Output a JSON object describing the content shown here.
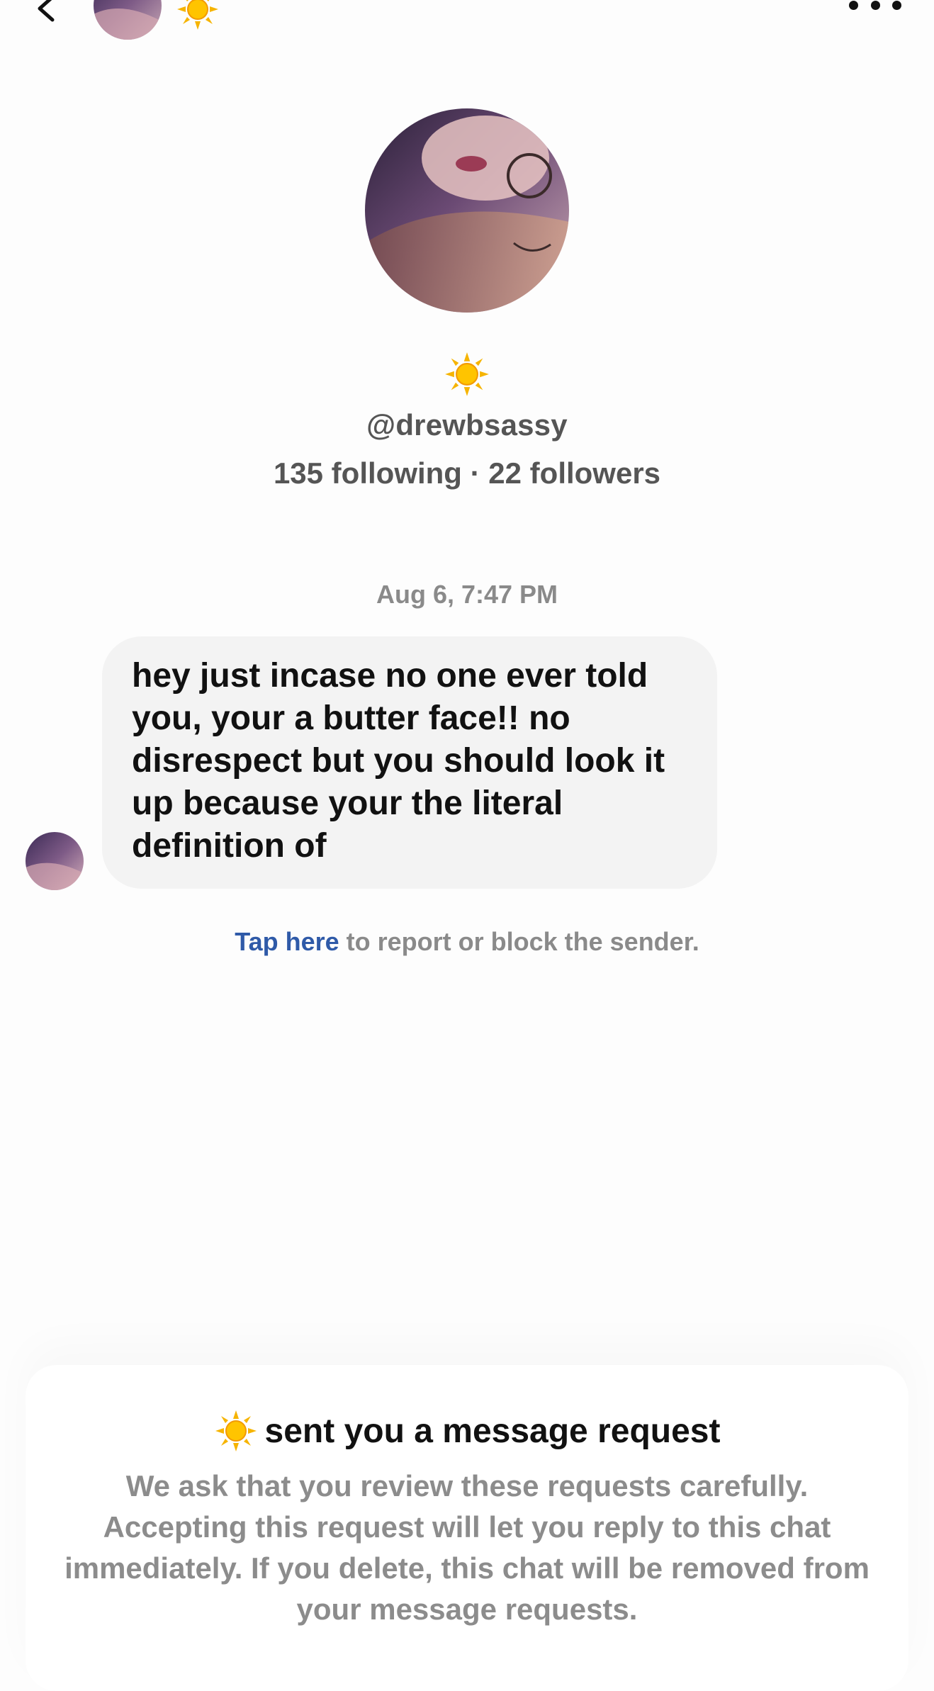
{
  "header": {
    "back_icon": "chevron-left-icon",
    "avatar": "profile-photo",
    "name_emoji_icon": "sun-icon",
    "more_icon": "ellipsis-icon"
  },
  "profile": {
    "avatar": "profile-photo",
    "emoji_icon": "sun-icon",
    "username": "@drewbsassy",
    "stats": "135 following · 22 followers"
  },
  "conversation": {
    "timestamp": "Aug 6, 7:47 PM",
    "message_text": "hey just incase no one ever told you, your a butter face!! no disrespect but you should look it up because your the literal definition of",
    "report_link": "Tap here",
    "report_text": " to report or block the sender."
  },
  "request_card": {
    "title_icon": "sun-icon",
    "title": "sent you a message request",
    "body": "We ask that you review these requests carefully. Accepting this request will let you reply to this chat immediately. If you delete, this chat will be removed from your message requests."
  },
  "colors": {
    "link": "#2f5aa8",
    "bubble": "#f3f3f3",
    "muted_text": "#8a8a8a",
    "sun": "#f6b400"
  }
}
